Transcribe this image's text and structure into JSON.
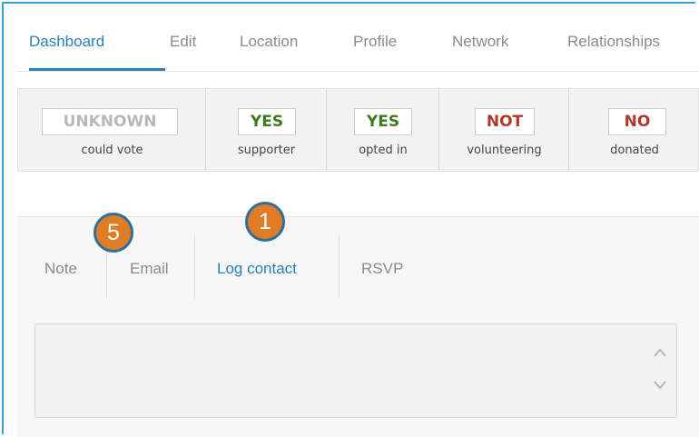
{
  "tabs": [
    "Dashboard",
    "Edit",
    "Location",
    "Profile",
    "Network",
    "Relationships"
  ],
  "status": [
    {
      "value": "UNKNOWN",
      "label": "could vote",
      "color": "#b8b8b8"
    },
    {
      "value": "YES",
      "label": "supporter",
      "color": "#3d7a22"
    },
    {
      "value": "YES",
      "label": "opted in",
      "color": "#3d7a22"
    },
    {
      "value": "NOT",
      "label": "volunteering",
      "color": "#b03a2a"
    },
    {
      "value": "NO",
      "label": "donated",
      "color": "#b03a2a"
    }
  ],
  "activity_tabs": [
    "Note",
    "Email",
    "Log contact",
    "RSVP"
  ],
  "callouts": [
    "5",
    "1"
  ],
  "colors": {
    "accent": "#2a7fb6",
    "callout_fill": "#e07b26",
    "callout_border": "#2e6f9e"
  }
}
